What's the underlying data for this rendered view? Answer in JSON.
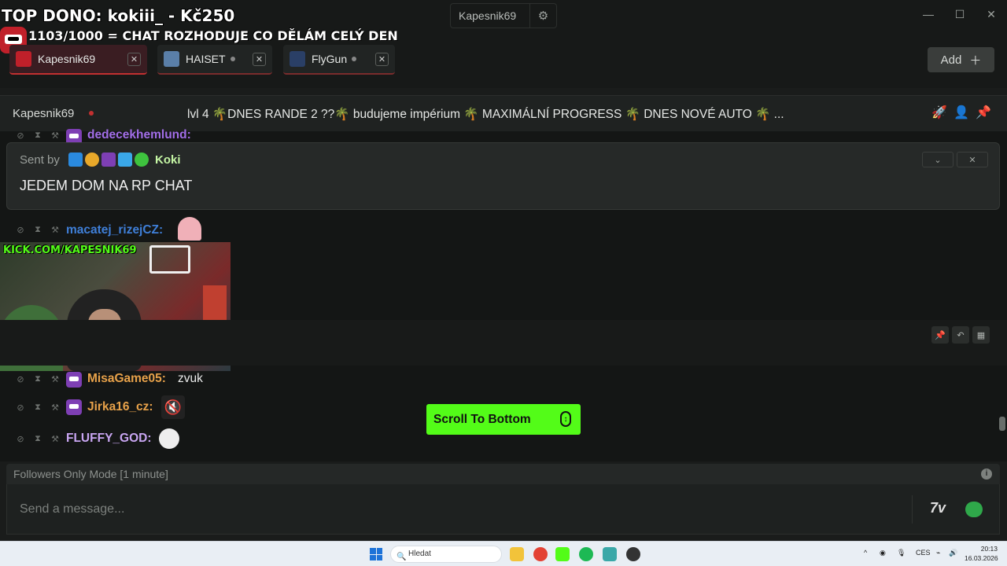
{
  "overlay": {
    "top_dono": "TOP DONO: kokiii_ - Kč250",
    "subline": "1103/1000 = CHAT ROZHODUJE CO DĚLÁM CELÝ DEN"
  },
  "window": {
    "account": "Kapesnik69",
    "minimize": "—",
    "maximize": "☐",
    "close": "✕"
  },
  "tabs": [
    {
      "label": "Kapesnik69",
      "active": true
    },
    {
      "label": "HAISET",
      "active": false
    },
    {
      "label": "FlyGun",
      "active": false
    }
  ],
  "add_button": "Add",
  "channel": {
    "name": "Kapesnik69",
    "stream_title": "lvl 4 🌴DNES RANDE 2 ??🌴 budujeme impérium 🌴 MAXIMÁLNÍ PROGRESS 🌴 DNES NOVÉ AUTO 🌴 ..."
  },
  "pinned": {
    "sent_by_label": "Sent by",
    "sender": "Koki",
    "message": "JEDEM DOM NA RP CHAT"
  },
  "video": {
    "overlay_text": "KICK.COM/KAPESNIK69"
  },
  "messages": [
    {
      "user": "dedecekhemlund:",
      "text": "",
      "color": "#a26ee8"
    },
    {
      "user": "macatej_rizejCZ:",
      "text": "",
      "color": "#3f7fd8"
    },
    {
      "user": "MisaGame05:",
      "text": "zvuk",
      "color": "#e8a24a"
    },
    {
      "user": "Jirka16_cz:",
      "text": "",
      "color": "#e8a24a"
    },
    {
      "user": "FLUFFY_GOD:",
      "text": "",
      "color": "#c9a6f2"
    }
  ],
  "scroll_to_bottom": "Scroll To Bottom",
  "followers_mode": "Followers Only Mode [1 minute]",
  "composer": {
    "placeholder": "Send a message..."
  },
  "taskbar": {
    "search": "Hledat",
    "lang": "CES",
    "time": "20:13",
    "date": "16.03.2026"
  },
  "colors": {
    "kick_green": "#53fc18",
    "live_red": "#c23030"
  }
}
